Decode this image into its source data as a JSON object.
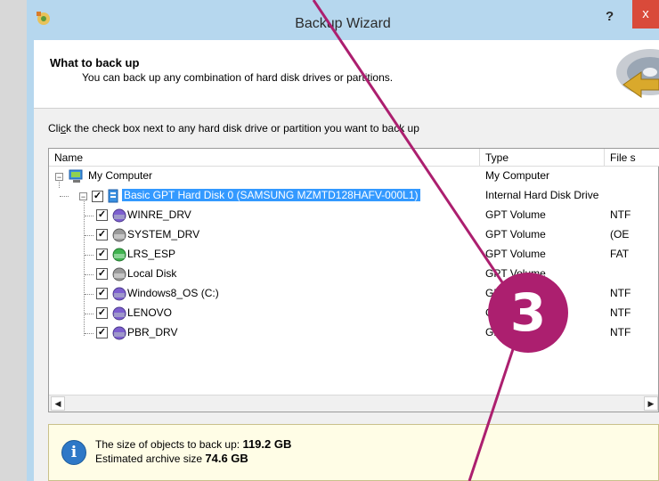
{
  "window": {
    "title": "Backup Wizard",
    "help_label": "?",
    "close_label": "x"
  },
  "header": {
    "title": "What to back up",
    "subtitle": "You can back up any combination of hard disk drives or partitions."
  },
  "instruction": {
    "before": "Cli",
    "accel": "c",
    "after": "k the check box next to any hard disk drive or partition you want to back up"
  },
  "grid": {
    "columns": {
      "name": "Name",
      "type": "Type",
      "fs": "File s"
    },
    "rows": [
      {
        "name": "My Computer",
        "type": "My Computer",
        "fs": ""
      },
      {
        "name": "Basic GPT Hard Disk 0 (SAMSUNG MZMTD128HAFV-000L1)",
        "type": "Internal Hard Disk Drive",
        "fs": "",
        "checked": true,
        "selected": true
      },
      {
        "name": "WINRE_DRV",
        "type": "GPT Volume",
        "fs": "NTF",
        "checked": true,
        "icon_color": "#7d5fd0"
      },
      {
        "name": "SYSTEM_DRV",
        "type": "GPT Volume",
        "fs": "(OE",
        "checked": true,
        "icon_color": "#9a9a9a"
      },
      {
        "name": "LRS_ESP",
        "type": "GPT Volume",
        "fs": "FAT",
        "checked": true,
        "icon_color": "#3fb34f"
      },
      {
        "name": "Local Disk",
        "type": "GPT Volume",
        "fs": "",
        "checked": true,
        "icon_color": "#9a9a9a"
      },
      {
        "name": "Windows8_OS (C:)",
        "type": "GPT Volume",
        "fs": "NTF",
        "checked": true,
        "icon_color": "#7d5fd0"
      },
      {
        "name": "LENOVO",
        "type": "GPT Volume",
        "fs": "NTF",
        "checked": true,
        "icon_color": "#7d5fd0"
      },
      {
        "name": "PBR_DRV",
        "type": "GPT Volume",
        "fs": "NTF",
        "checked": true,
        "icon_color": "#7d5fd0"
      }
    ],
    "scroll_left": "◀",
    "scroll_right": "▶"
  },
  "info": {
    "line1_label": "The size of objects to back up:",
    "line1_value": "119.2 GB",
    "line2_label": "Estimated archive size",
    "line2_value": "74.6 GB",
    "icon_glyph": "i"
  },
  "annotation": {
    "step_number": "3",
    "color": "#ac1f6f"
  },
  "colors": {
    "selection": "#3399ff",
    "title_bar": "#b6d7ee",
    "close_button": "#d94a3a",
    "info_background": "#fffde6"
  }
}
